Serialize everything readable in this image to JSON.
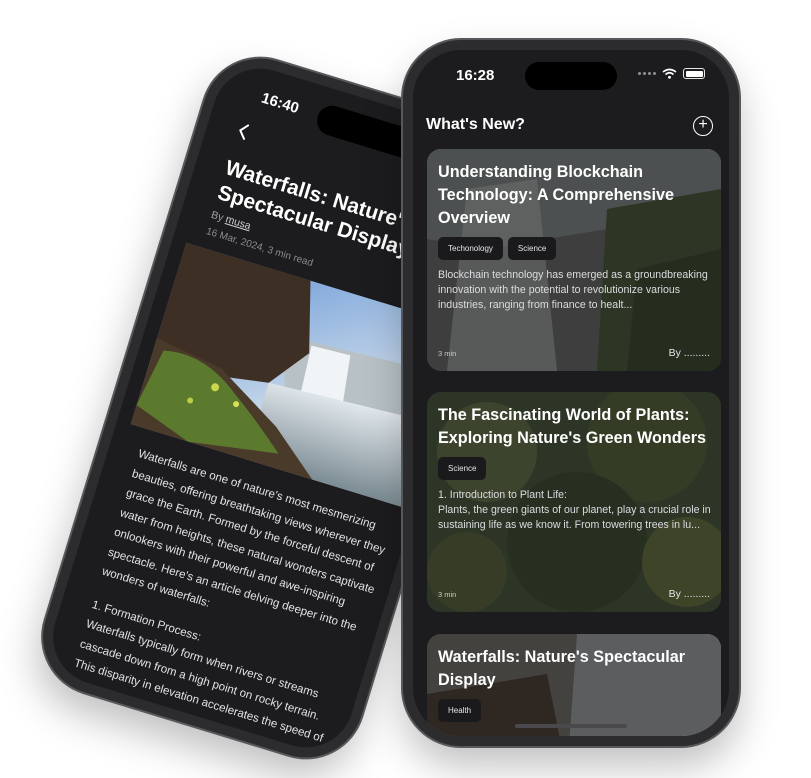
{
  "detail_screen": {
    "time": "16:40",
    "back_icon": "chevron-left-icon",
    "more_text": "...",
    "title": "Waterfalls: Nature's Spectacular Display",
    "by_prefix": "By",
    "author": "musa",
    "meta": "16 Mar, 2024, 3 min read",
    "paragraph_1": "Waterfalls are one of nature's most mesmerizing beauties, offering breathtaking views wherever they grace the Earth. Formed by the forceful descent of water from heights, these natural wonders captivate onlookers with their powerful and awe-inspiring spectacle. Here's an article delving deeper into the wonders of waterfalls:",
    "section_heading": "1. Formation Process:",
    "paragraph_2": "Waterfalls typically form when rivers or streams cascade down from a high point on rocky terrain. This disparity in elevation accelerates the speed of the"
  },
  "feed_screen": {
    "time": "16:28",
    "header_title": "What's New?",
    "add_icon": "plus-circle-icon",
    "cards": [
      {
        "title": "Understanding Blockchain Technology: A Comprehensive Overview",
        "tags": [
          "Techonology",
          "Science"
        ],
        "excerpt": "Blockchain technology has emerged as a groundbreaking innovation with the potential to revolutionize various industries, ranging from finance to healt...",
        "read_time": "3 min",
        "by": "By ........."
      },
      {
        "title": "The Fascinating World of Plants: Exploring Nature's Green Wonders",
        "tags": [
          "Science"
        ],
        "excerpt": "1. Introduction to Plant Life:\nPlants, the green giants of our planet, play a crucial role in sustaining life as we know it. From towering trees in lu...",
        "read_time": "3 min",
        "by": "By ........."
      },
      {
        "title": "Waterfalls: Nature's Spectacular Display",
        "tags": [
          "Health"
        ],
        "excerpt": "",
        "read_time": "",
        "by": ""
      }
    ]
  }
}
